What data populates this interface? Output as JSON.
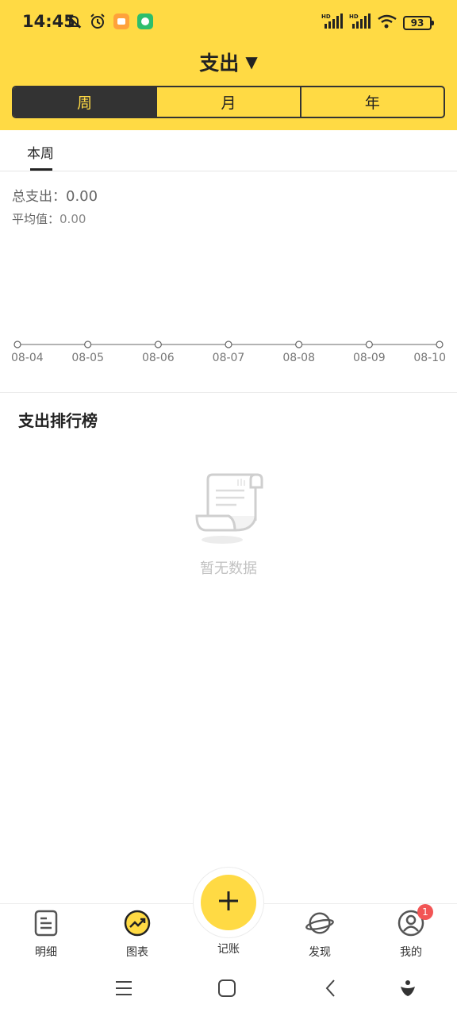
{
  "status_bar": {
    "time": "14:45",
    "battery": "93"
  },
  "header": {
    "title": "支出",
    "dropdown_icon": "caret-down-icon",
    "segments": [
      {
        "label": "周",
        "active": true
      },
      {
        "label": "月",
        "active": false
      },
      {
        "label": "年",
        "active": false
      }
    ]
  },
  "period": {
    "tab": "本周"
  },
  "summary": {
    "total_label": "总支出：",
    "total_value": "0.00",
    "avg_label": "平均值：",
    "avg_value": "0.00"
  },
  "chart_data": {
    "type": "line",
    "categories": [
      "08-04",
      "08-05",
      "08-06",
      "08-07",
      "08-08",
      "08-09",
      "08-10"
    ],
    "values": [
      0,
      0,
      0,
      0,
      0,
      0,
      0
    ]
  },
  "ranking": {
    "title": "支出排行榜",
    "empty_text": "暂无数据"
  },
  "bottom_nav": {
    "items": [
      {
        "label": "明细",
        "icon": "list-icon"
      },
      {
        "label": "图表",
        "icon": "chart-icon"
      },
      {
        "label": "记账",
        "icon": "plus-icon"
      },
      {
        "label": "发现",
        "icon": "planet-icon"
      },
      {
        "label": "我的",
        "icon": "user-icon",
        "badge": "1"
      }
    ]
  },
  "colors": {
    "accent": "#FFDA44",
    "dark": "#333333",
    "badge": "#F25555"
  }
}
